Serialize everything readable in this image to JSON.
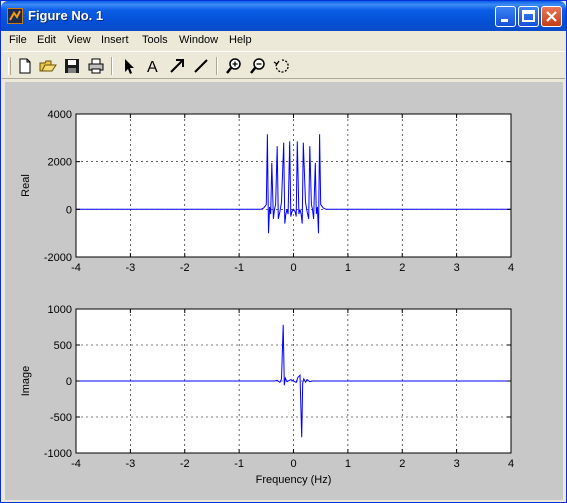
{
  "window": {
    "title": "Figure No. 1"
  },
  "menu": [
    "File",
    "Edit",
    "View",
    "Insert",
    "Tools",
    "Window",
    "Help"
  ],
  "toolbar": [
    "new-figure-icon",
    "open-folder-icon",
    "save-icon",
    "print-icon",
    "edit-plot-arrow-icon",
    "insert-text-icon",
    "insert-arrow-icon",
    "insert-line-icon",
    "zoom-in-icon",
    "zoom-out-icon",
    "rotate-3d-icon"
  ],
  "colors": {
    "line": "#0000ff",
    "figure_bg": "#c8c8c8",
    "axes_bg": "#ffffff"
  },
  "chart_data": [
    {
      "type": "line",
      "name": "real",
      "xlabel": "",
      "ylabel": "Real",
      "xlim": [
        -4,
        4
      ],
      "ylim": [
        -2000,
        4000
      ],
      "xticks": [
        -4,
        -3,
        -2,
        -1,
        0,
        1,
        2,
        3,
        4
      ],
      "xtick_labels": [
        "-4",
        "-3",
        "-2",
        "-1",
        "0",
        "1",
        "2",
        "3",
        "4"
      ],
      "yticks": [
        -2000,
        0,
        2000,
        4000
      ],
      "ytick_labels": [
        "-2000",
        "0",
        "2000",
        "4000"
      ],
      "grid": true,
      "series": [
        {
          "x": [
            -4,
            -0.6,
            -0.55,
            -0.5,
            -0.48,
            -0.46,
            -0.44,
            -0.42,
            -0.4,
            -0.37,
            -0.35,
            -0.33,
            -0.3,
            -0.28,
            -0.25,
            -0.22,
            -0.18,
            -0.16,
            -0.14,
            -0.12,
            -0.1,
            -0.07,
            -0.05,
            -0.03,
            0,
            0.03,
            0.05,
            0.07,
            0.1,
            0.12,
            0.14,
            0.16,
            0.18,
            0.22,
            0.25,
            0.28,
            0.3,
            0.33,
            0.35,
            0.37,
            0.4,
            0.42,
            0.44,
            0.46,
            0.48,
            0.5,
            0.55,
            0.6,
            4
          ],
          "y": [
            0,
            0,
            50,
            200,
            3150,
            -1000,
            100,
            -200,
            1950,
            -400,
            0,
            200,
            2650,
            -400,
            -100,
            300,
            2800,
            -600,
            -200,
            0,
            -200,
            2850,
            -300,
            -100,
            0,
            -100,
            -300,
            2850,
            -200,
            0,
            -200,
            -600,
            2800,
            300,
            -100,
            -400,
            2650,
            200,
            0,
            -400,
            1950,
            -200,
            100,
            -1000,
            3150,
            200,
            50,
            0,
            0
          ]
        }
      ]
    },
    {
      "type": "line",
      "name": "image",
      "xlabel": "Frequency (Hz)",
      "ylabel": "Image",
      "xlim": [
        -4,
        4
      ],
      "ylim": [
        -1000,
        1000
      ],
      "xticks": [
        -4,
        -3,
        -2,
        -1,
        0,
        1,
        2,
        3,
        4
      ],
      "xtick_labels": [
        "-4",
        "-3",
        "-2",
        "-1",
        "0",
        "1",
        "2",
        "3",
        "4"
      ],
      "yticks": [
        -1000,
        -500,
        0,
        500,
        1000
      ],
      "ytick_labels": [
        "-1000",
        "-500",
        "0",
        "500",
        "1000"
      ],
      "grid": true,
      "series": [
        {
          "x": [
            -4,
            -0.35,
            -0.3,
            -0.25,
            -0.22,
            -0.19,
            -0.17,
            -0.15,
            -0.12,
            -0.08,
            -0.05,
            0,
            0.05,
            0.08,
            0.12,
            0.15,
            0.17,
            0.19,
            0.22,
            0.25,
            0.3,
            0.35,
            4
          ],
          "y": [
            0,
            0,
            10,
            -20,
            30,
            780,
            -60,
            40,
            -10,
            5,
            20,
            0,
            -20,
            50,
            80,
            -780,
            -30,
            30,
            -15,
            20,
            -10,
            0,
            0
          ]
        }
      ]
    }
  ]
}
